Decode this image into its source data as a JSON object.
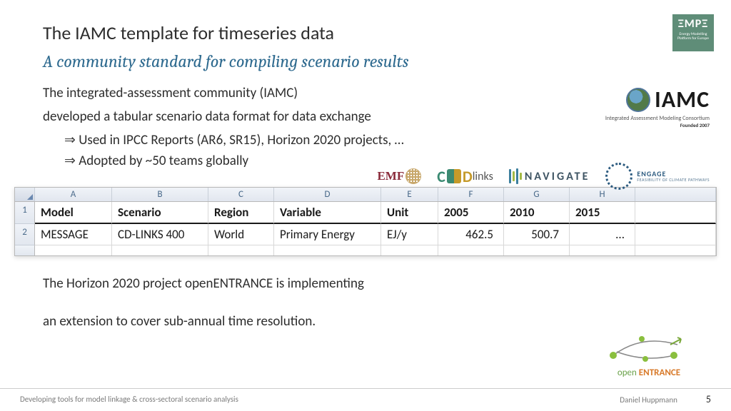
{
  "title": "The IAMC template for timeseries data",
  "subtitle": "A community standard for compiling scenario results",
  "body_line1": "The integrated-assessment community (IAMC)",
  "body_line2": "developed a tabular scenario data format for data exchange",
  "bullets": [
    "Used in IPCC Reports (AR6, SR15), Horizon 2020 projects, …",
    "Adopted by ~50 teams globally"
  ],
  "logos": {
    "empe": {
      "title": "ΞMPΞ",
      "subtitle": "Energy Modelling\nPlatform for Europe"
    },
    "iamc": {
      "text": "IAMC",
      "sub": "Integrated Assessment Modeling Consortium",
      "founded": "Founded 2007"
    },
    "emf": "EMF",
    "cdlinks": {
      "c": "C",
      "d": "D",
      "rest": "links"
    },
    "navigate": "NAVIGATE",
    "engage": {
      "main": "ENGAGE",
      "sub": "FEASIBILITY OF\nCLIMATE PATHWAYS"
    },
    "open": {
      "left": "open",
      "right": "ENTRANCE"
    }
  },
  "spreadsheet": {
    "cols": [
      "",
      "A",
      "B",
      "C",
      "D",
      "E",
      "F",
      "G",
      "H"
    ],
    "rows": [
      {
        "num": "1",
        "cells": [
          "Model",
          "Scenario",
          "Region",
          "Variable",
          "Unit",
          "2005",
          "2010",
          "2015"
        ]
      },
      {
        "num": "2",
        "cells": [
          "MESSAGE",
          "CD-LINKS 400",
          "World",
          "Primary Energy",
          "EJ/y",
          "462.5",
          "500.7",
          "..."
        ]
      }
    ]
  },
  "chart_data": {
    "type": "table",
    "columns": [
      "Model",
      "Scenario",
      "Region",
      "Variable",
      "Unit",
      "2005",
      "2010",
      "2015"
    ],
    "rows": [
      [
        "MESSAGE",
        "CD-LINKS 400",
        "World",
        "Primary Energy",
        "EJ/y",
        462.5,
        500.7,
        null
      ]
    ]
  },
  "post_line1": "The Horizon 2020 project openENTRANCE is implementing",
  "post_line2": "an extension to cover sub-annual time resolution.",
  "footer": {
    "left": "Developing tools for model linkage & cross-sectoral scenario analysis",
    "author": "Daniel Huppmann",
    "page": "5"
  }
}
